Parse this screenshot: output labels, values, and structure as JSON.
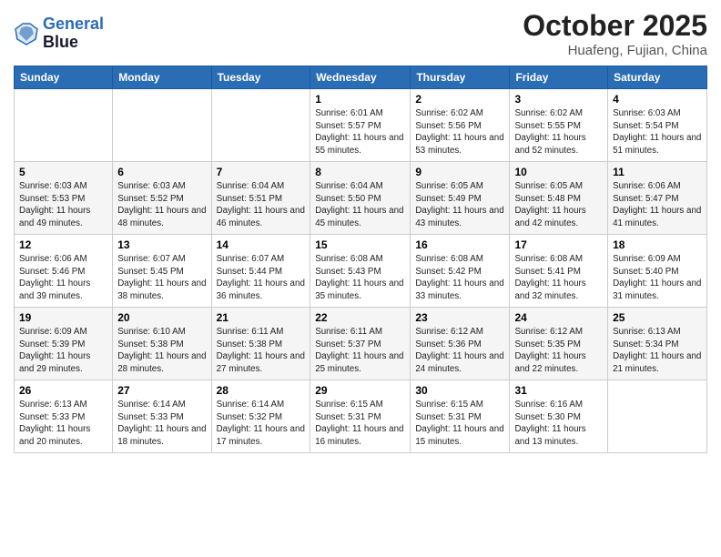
{
  "header": {
    "logo_line1": "General",
    "logo_line2": "Blue",
    "month": "October 2025",
    "location": "Huafeng, Fujian, China"
  },
  "weekdays": [
    "Sunday",
    "Monday",
    "Tuesday",
    "Wednesday",
    "Thursday",
    "Friday",
    "Saturday"
  ],
  "weeks": [
    [
      {
        "day": "",
        "sunrise": "",
        "sunset": "",
        "daylight": ""
      },
      {
        "day": "",
        "sunrise": "",
        "sunset": "",
        "daylight": ""
      },
      {
        "day": "",
        "sunrise": "",
        "sunset": "",
        "daylight": ""
      },
      {
        "day": "1",
        "sunrise": "Sunrise: 6:01 AM",
        "sunset": "Sunset: 5:57 PM",
        "daylight": "Daylight: 11 hours and 55 minutes."
      },
      {
        "day": "2",
        "sunrise": "Sunrise: 6:02 AM",
        "sunset": "Sunset: 5:56 PM",
        "daylight": "Daylight: 11 hours and 53 minutes."
      },
      {
        "day": "3",
        "sunrise": "Sunrise: 6:02 AM",
        "sunset": "Sunset: 5:55 PM",
        "daylight": "Daylight: 11 hours and 52 minutes."
      },
      {
        "day": "4",
        "sunrise": "Sunrise: 6:03 AM",
        "sunset": "Sunset: 5:54 PM",
        "daylight": "Daylight: 11 hours and 51 minutes."
      }
    ],
    [
      {
        "day": "5",
        "sunrise": "Sunrise: 6:03 AM",
        "sunset": "Sunset: 5:53 PM",
        "daylight": "Daylight: 11 hours and 49 minutes."
      },
      {
        "day": "6",
        "sunrise": "Sunrise: 6:03 AM",
        "sunset": "Sunset: 5:52 PM",
        "daylight": "Daylight: 11 hours and 48 minutes."
      },
      {
        "day": "7",
        "sunrise": "Sunrise: 6:04 AM",
        "sunset": "Sunset: 5:51 PM",
        "daylight": "Daylight: 11 hours and 46 minutes."
      },
      {
        "day": "8",
        "sunrise": "Sunrise: 6:04 AM",
        "sunset": "Sunset: 5:50 PM",
        "daylight": "Daylight: 11 hours and 45 minutes."
      },
      {
        "day": "9",
        "sunrise": "Sunrise: 6:05 AM",
        "sunset": "Sunset: 5:49 PM",
        "daylight": "Daylight: 11 hours and 43 minutes."
      },
      {
        "day": "10",
        "sunrise": "Sunrise: 6:05 AM",
        "sunset": "Sunset: 5:48 PM",
        "daylight": "Daylight: 11 hours and 42 minutes."
      },
      {
        "day": "11",
        "sunrise": "Sunrise: 6:06 AM",
        "sunset": "Sunset: 5:47 PM",
        "daylight": "Daylight: 11 hours and 41 minutes."
      }
    ],
    [
      {
        "day": "12",
        "sunrise": "Sunrise: 6:06 AM",
        "sunset": "Sunset: 5:46 PM",
        "daylight": "Daylight: 11 hours and 39 minutes."
      },
      {
        "day": "13",
        "sunrise": "Sunrise: 6:07 AM",
        "sunset": "Sunset: 5:45 PM",
        "daylight": "Daylight: 11 hours and 38 minutes."
      },
      {
        "day": "14",
        "sunrise": "Sunrise: 6:07 AM",
        "sunset": "Sunset: 5:44 PM",
        "daylight": "Daylight: 11 hours and 36 minutes."
      },
      {
        "day": "15",
        "sunrise": "Sunrise: 6:08 AM",
        "sunset": "Sunset: 5:43 PM",
        "daylight": "Daylight: 11 hours and 35 minutes."
      },
      {
        "day": "16",
        "sunrise": "Sunrise: 6:08 AM",
        "sunset": "Sunset: 5:42 PM",
        "daylight": "Daylight: 11 hours and 33 minutes."
      },
      {
        "day": "17",
        "sunrise": "Sunrise: 6:08 AM",
        "sunset": "Sunset: 5:41 PM",
        "daylight": "Daylight: 11 hours and 32 minutes."
      },
      {
        "day": "18",
        "sunrise": "Sunrise: 6:09 AM",
        "sunset": "Sunset: 5:40 PM",
        "daylight": "Daylight: 11 hours and 31 minutes."
      }
    ],
    [
      {
        "day": "19",
        "sunrise": "Sunrise: 6:09 AM",
        "sunset": "Sunset: 5:39 PM",
        "daylight": "Daylight: 11 hours and 29 minutes."
      },
      {
        "day": "20",
        "sunrise": "Sunrise: 6:10 AM",
        "sunset": "Sunset: 5:38 PM",
        "daylight": "Daylight: 11 hours and 28 minutes."
      },
      {
        "day": "21",
        "sunrise": "Sunrise: 6:11 AM",
        "sunset": "Sunset: 5:38 PM",
        "daylight": "Daylight: 11 hours and 27 minutes."
      },
      {
        "day": "22",
        "sunrise": "Sunrise: 6:11 AM",
        "sunset": "Sunset: 5:37 PM",
        "daylight": "Daylight: 11 hours and 25 minutes."
      },
      {
        "day": "23",
        "sunrise": "Sunrise: 6:12 AM",
        "sunset": "Sunset: 5:36 PM",
        "daylight": "Daylight: 11 hours and 24 minutes."
      },
      {
        "day": "24",
        "sunrise": "Sunrise: 6:12 AM",
        "sunset": "Sunset: 5:35 PM",
        "daylight": "Daylight: 11 hours and 22 minutes."
      },
      {
        "day": "25",
        "sunrise": "Sunrise: 6:13 AM",
        "sunset": "Sunset: 5:34 PM",
        "daylight": "Daylight: 11 hours and 21 minutes."
      }
    ],
    [
      {
        "day": "26",
        "sunrise": "Sunrise: 6:13 AM",
        "sunset": "Sunset: 5:33 PM",
        "daylight": "Daylight: 11 hours and 20 minutes."
      },
      {
        "day": "27",
        "sunrise": "Sunrise: 6:14 AM",
        "sunset": "Sunset: 5:33 PM",
        "daylight": "Daylight: 11 hours and 18 minutes."
      },
      {
        "day": "28",
        "sunrise": "Sunrise: 6:14 AM",
        "sunset": "Sunset: 5:32 PM",
        "daylight": "Daylight: 11 hours and 17 minutes."
      },
      {
        "day": "29",
        "sunrise": "Sunrise: 6:15 AM",
        "sunset": "Sunset: 5:31 PM",
        "daylight": "Daylight: 11 hours and 16 minutes."
      },
      {
        "day": "30",
        "sunrise": "Sunrise: 6:15 AM",
        "sunset": "Sunset: 5:31 PM",
        "daylight": "Daylight: 11 hours and 15 minutes."
      },
      {
        "day": "31",
        "sunrise": "Sunrise: 6:16 AM",
        "sunset": "Sunset: 5:30 PM",
        "daylight": "Daylight: 11 hours and 13 minutes."
      },
      {
        "day": "",
        "sunrise": "",
        "sunset": "",
        "daylight": ""
      }
    ]
  ]
}
